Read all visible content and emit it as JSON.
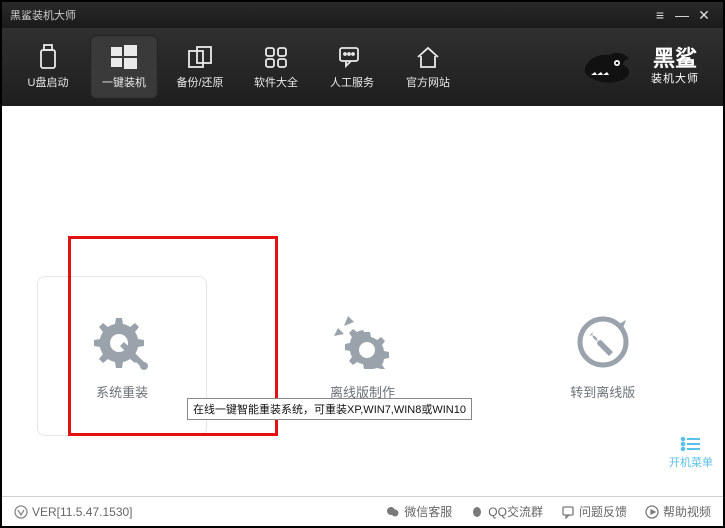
{
  "title": "黑鲨装机大师",
  "brand": {
    "line1": "黑鲨",
    "line2": "装机大师"
  },
  "nav": [
    {
      "key": "usb",
      "label": "U盘启动"
    },
    {
      "key": "oneclick",
      "label": "一键装机"
    },
    {
      "key": "backup",
      "label": "备份/还原"
    },
    {
      "key": "software",
      "label": "软件大全"
    },
    {
      "key": "support",
      "label": "人工服务"
    },
    {
      "key": "site",
      "label": "官方网站"
    }
  ],
  "active_nav": 1,
  "cards": [
    {
      "key": "reinstall",
      "label": "系统重装"
    },
    {
      "key": "offline",
      "label": "离线版制作"
    },
    {
      "key": "goto-offline",
      "label": "转到离线版"
    }
  ],
  "tooltip": "在线一键智能重装系统，可重装XP,WIN7,WIN8或WIN10",
  "bootmenu": "开机菜单",
  "version": "VER[11.5.47.1530]",
  "status": [
    {
      "key": "wechat",
      "label": "微信客服"
    },
    {
      "key": "qq",
      "label": "QQ交流群"
    },
    {
      "key": "feedback",
      "label": "问题反馈"
    },
    {
      "key": "video",
      "label": "帮助视频"
    }
  ]
}
